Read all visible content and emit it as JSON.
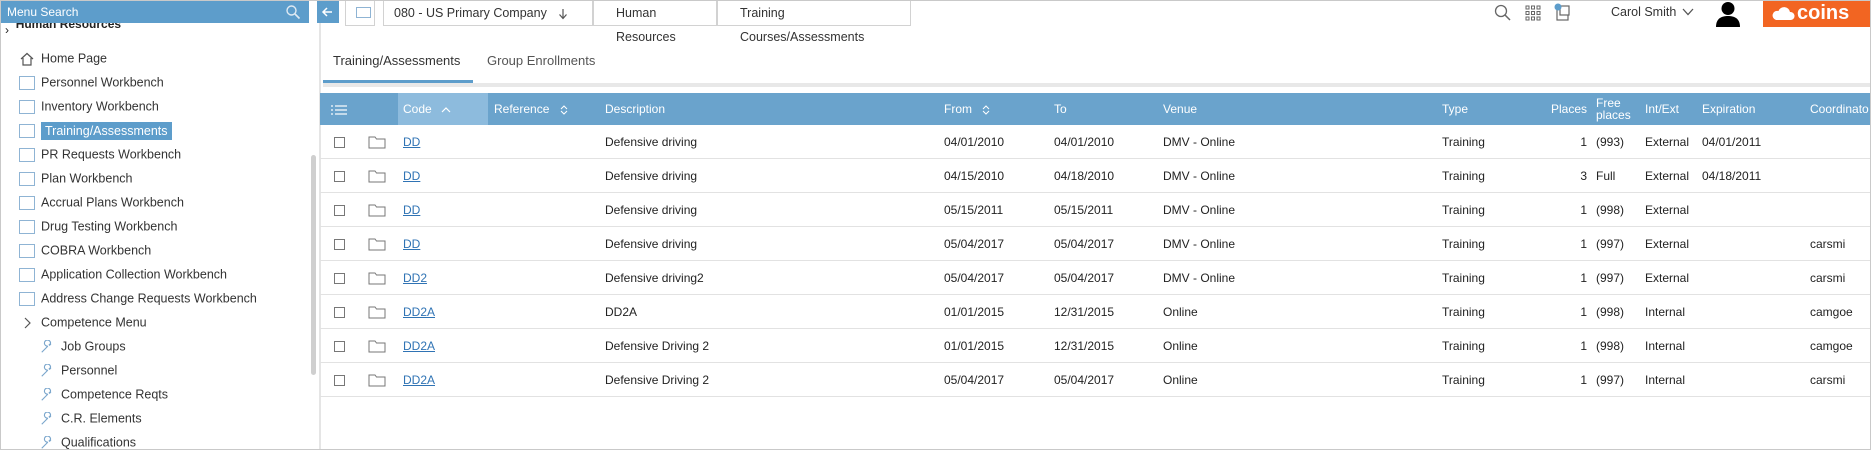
{
  "sidebar": {
    "search_label": "Menu Search",
    "tree_root": "Human Resources",
    "items": [
      {
        "label": "Home Page"
      },
      {
        "label": "Personnel Workbench"
      },
      {
        "label": "Inventory Workbench"
      },
      {
        "label": "Training/Assessments"
      },
      {
        "label": "PR Requests Workbench"
      },
      {
        "label": "Plan Workbench"
      },
      {
        "label": "Accrual Plans Workbench"
      },
      {
        "label": "Drug Testing Workbench"
      },
      {
        "label": "COBRA Workbench"
      },
      {
        "label": "Application Collection Workbench"
      },
      {
        "label": "Address Change Requests Workbench"
      },
      {
        "label": "Competence Menu"
      }
    ],
    "selected_item": "Training/Assessments",
    "sub_items": [
      {
        "label": "Job Groups"
      },
      {
        "label": "Personnel"
      },
      {
        "label": "Competence Reqts"
      },
      {
        "label": "C.R. Elements"
      },
      {
        "label": "Qualifications"
      }
    ]
  },
  "breadcrumbs": {
    "company": "080 - US Primary Company",
    "section": "Human Resources",
    "page": "Training Courses/Assessments"
  },
  "user": {
    "name": "Carol Smith"
  },
  "logo_text": "coins",
  "accent_color": "#5d9dcb",
  "brand_color": "#f26522",
  "tabs": [
    {
      "label": "Training/Assessments",
      "active": true
    },
    {
      "label": "Group Enrollments",
      "active": false
    }
  ],
  "table": {
    "columns": {
      "code": "Code",
      "reference": "Reference",
      "description": "Description",
      "from": "From",
      "to": "To",
      "venue": "Venue",
      "type": "Type",
      "places": "Places",
      "free_places_1": "Free",
      "free_places_2": "places",
      "int_ext": "Int/Ext",
      "expiration": "Expiration",
      "coordinator": "Coordinato"
    },
    "sorted_column": "Code",
    "rows": [
      {
        "code": "DD",
        "description": "Defensive driving",
        "from": "04/01/2010",
        "to": "04/01/2010",
        "venue": "DMV - Online",
        "type": "Training",
        "places": "1",
        "free": "(993)",
        "int_ext": "External",
        "expiration": "04/01/2011",
        "coordinator": ""
      },
      {
        "code": "DD",
        "description": "Defensive driving",
        "from": "04/15/2010",
        "to": "04/18/2010",
        "venue": "DMV - Online",
        "type": "Training",
        "places": "3",
        "free": "Full",
        "int_ext": "External",
        "expiration": "04/18/2011",
        "coordinator": ""
      },
      {
        "code": "DD",
        "description": "Defensive driving",
        "from": "05/15/2011",
        "to": "05/15/2011",
        "venue": "DMV - Online",
        "type": "Training",
        "places": "1",
        "free": "(998)",
        "int_ext": "External",
        "expiration": "",
        "coordinator": ""
      },
      {
        "code": "DD",
        "description": "Defensive driving",
        "from": "05/04/2017",
        "to": "05/04/2017",
        "venue": "DMV - Online",
        "type": "Training",
        "places": "1",
        "free": "(997)",
        "int_ext": "External",
        "expiration": "",
        "coordinator": "carsmi"
      },
      {
        "code": "DD2",
        "description": "Defensive driving2",
        "from": "05/04/2017",
        "to": "05/04/2017",
        "venue": "DMV - Online",
        "type": "Training",
        "places": "1",
        "free": "(997)",
        "int_ext": "External",
        "expiration": "",
        "coordinator": "carsmi"
      },
      {
        "code": "DD2A",
        "description": "DD2A",
        "from": "01/01/2015",
        "to": "12/31/2015",
        "venue": "Online",
        "type": "Training",
        "places": "1",
        "free": "(998)",
        "int_ext": "Internal",
        "expiration": "",
        "coordinator": "camgoe"
      },
      {
        "code": "DD2A",
        "description": "Defensive Driving 2",
        "from": "01/01/2015",
        "to": "12/31/2015",
        "venue": "Online",
        "type": "Training",
        "places": "1",
        "free": "(998)",
        "int_ext": "Internal",
        "expiration": "",
        "coordinator": "camgoe"
      },
      {
        "code": "DD2A",
        "description": "Defensive Driving 2",
        "from": "05/04/2017",
        "to": "05/04/2017",
        "venue": "Online",
        "type": "Training",
        "places": "1",
        "free": "(997)",
        "int_ext": "Internal",
        "expiration": "",
        "coordinator": "carsmi"
      }
    ]
  }
}
